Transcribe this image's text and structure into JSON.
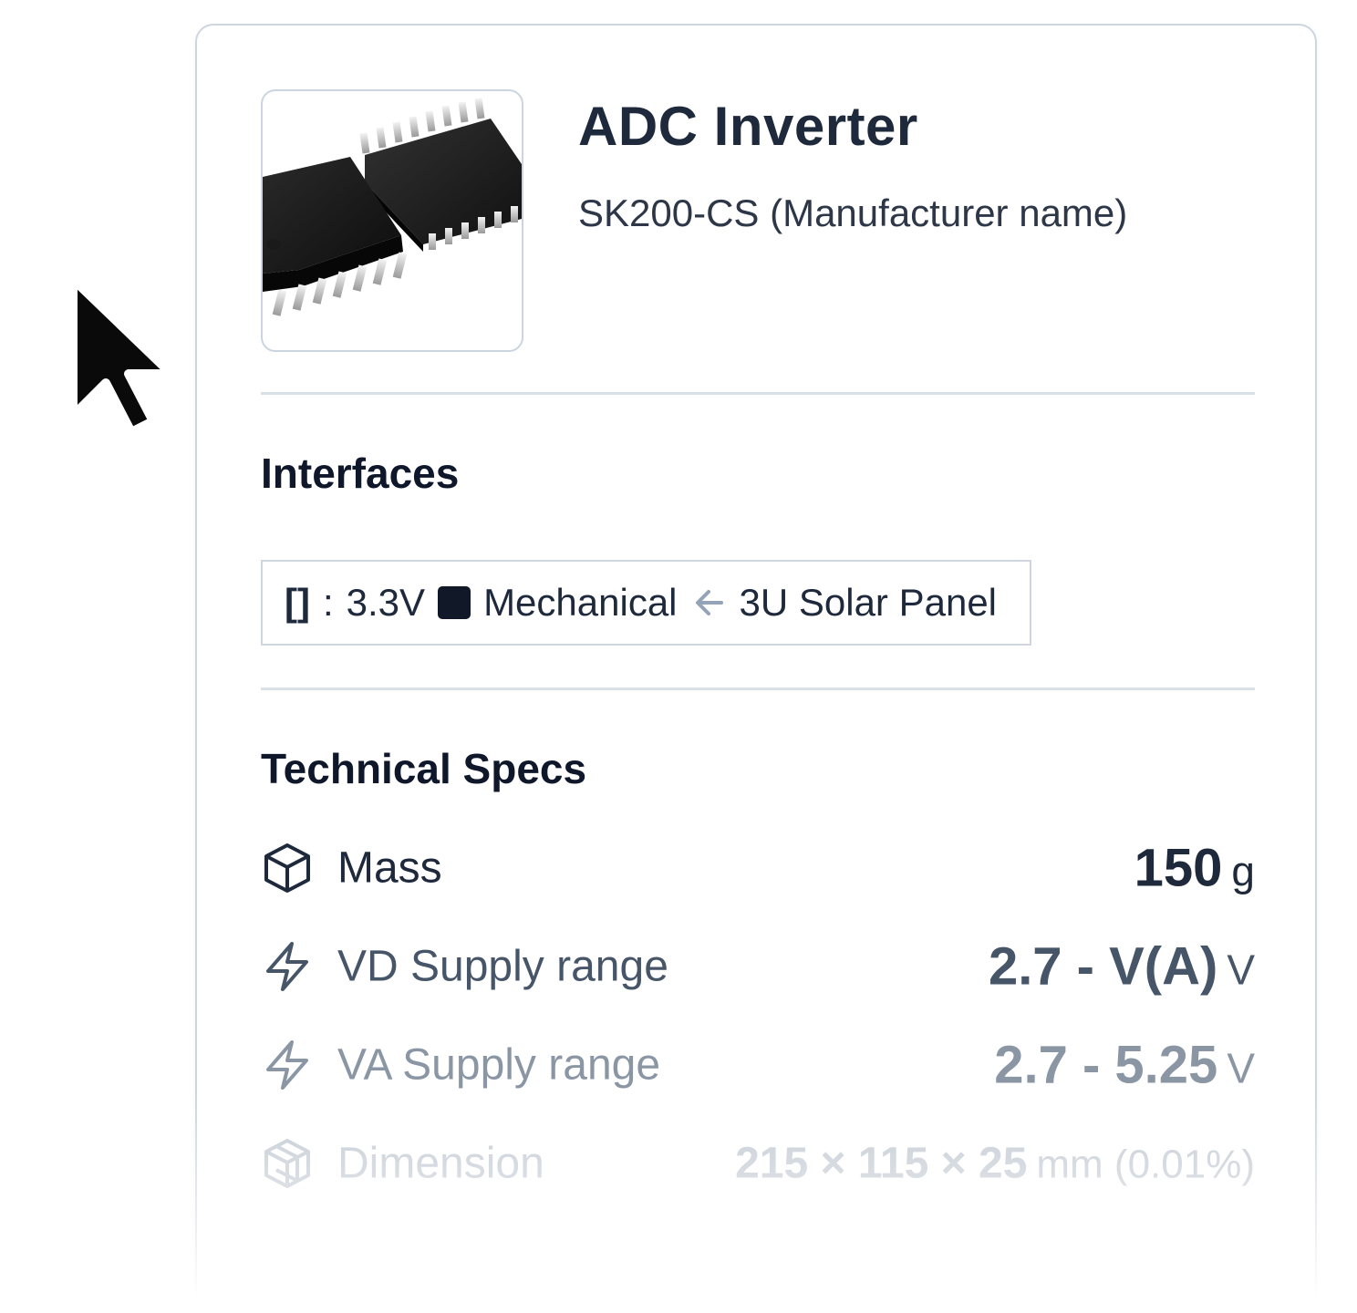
{
  "component": {
    "title": "ADC Inverter",
    "subtitle": "SK200-CS (Manufacturer name)",
    "image_icon": "ic-chip-photo"
  },
  "interfaces": {
    "heading": "Interfaces",
    "items": [
      {
        "bracket": "[]",
        "separator": ":",
        "voltage": "3.3V",
        "type_icon": "filled-square-icon",
        "type": "Mechanical",
        "direction_icon": "arrow-left-icon",
        "target": "3U Solar Panel"
      }
    ]
  },
  "specs": {
    "heading": "Technical Specs",
    "rows": [
      {
        "icon": "cube-icon",
        "label": "Mass",
        "value": "150",
        "unit": "g"
      },
      {
        "icon": "lightning-icon",
        "label": "VD Supply range",
        "value": "2.7 - V(A)",
        "unit": "V"
      },
      {
        "icon": "lightning-icon",
        "label": "VA Supply range",
        "value": "2.7 - 5.25",
        "unit": "V"
      },
      {
        "icon": "dimension-cube-icon",
        "label": "Dimension",
        "value": "215 × 115 × 25",
        "unit": "mm (0.01%)"
      }
    ]
  },
  "colors": {
    "text_primary": "#1e293b",
    "border": "#cfd6df",
    "chip_black": "#111827"
  }
}
